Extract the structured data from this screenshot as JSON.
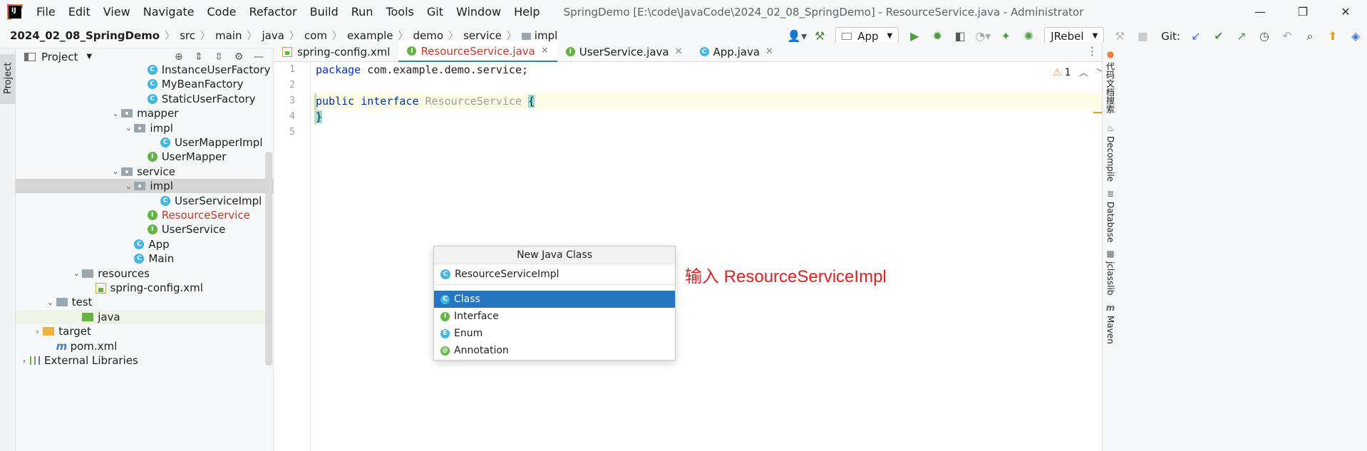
{
  "window": {
    "title": "SpringDemo [E:\\code\\JavaCode\\2024_02_08_SpringDemo] - ResourceService.java - Administrator"
  },
  "menu": [
    "File",
    "Edit",
    "View",
    "Navigate",
    "Code",
    "Refactor",
    "Build",
    "Run",
    "Tools",
    "Git",
    "Window",
    "Help"
  ],
  "window_controls": {
    "minimize": "—",
    "restore": "❐",
    "close": "✕"
  },
  "breadcrumb": [
    "2024_02_08_SpringDemo",
    "src",
    "main",
    "java",
    "com",
    "example",
    "demo",
    "service",
    "impl"
  ],
  "toolbar": {
    "run_config": "App",
    "jrebel": "JRebel",
    "git_label": "Git:",
    "icons": [
      "user-icon",
      "hammer-icon",
      "run-icon",
      "debug-icon",
      "coverage-icon",
      "profile-icon",
      "jrebel-run-icon",
      "jrebel-debug-icon",
      "stop-icon",
      "update-icon",
      "commit-icon",
      "push-icon",
      "history-icon",
      "rollback-icon",
      "search-icon",
      "updates-icon",
      "toolbox-icon"
    ]
  },
  "left_stripe": {
    "project_tab": "Project"
  },
  "project_panel": {
    "title": "Project",
    "tree": [
      {
        "label": "InstanceUserFactory",
        "icon": "class",
        "indent": 9
      },
      {
        "label": "MyBeanFactory",
        "icon": "class",
        "indent": 9
      },
      {
        "label": "StaticUserFactory",
        "icon": "class",
        "indent": 9
      },
      {
        "label": "mapper",
        "icon": "package",
        "indent": 7,
        "arrow": "⌄"
      },
      {
        "label": "impl",
        "icon": "package",
        "indent": 8,
        "arrow": "⌄"
      },
      {
        "label": "UserMapperImpl",
        "icon": "class",
        "indent": 10
      },
      {
        "label": "UserMapper",
        "icon": "interface",
        "indent": 9
      },
      {
        "label": "service",
        "icon": "package",
        "indent": 7,
        "arrow": "⌄"
      },
      {
        "label": "impl",
        "icon": "package",
        "indent": 8,
        "arrow": "⌄",
        "selected": true
      },
      {
        "label": "UserServiceImpl",
        "icon": "class",
        "indent": 10
      },
      {
        "label": "ResourceService",
        "icon": "interface",
        "indent": 9,
        "red": true
      },
      {
        "label": "UserService",
        "icon": "interface",
        "indent": 9
      },
      {
        "label": "App",
        "icon": "class-run",
        "indent": 8
      },
      {
        "label": "Main",
        "icon": "class-run",
        "indent": 8
      },
      {
        "label": "resources",
        "icon": "folder-res",
        "indent": 4,
        "arrow": "⌄"
      },
      {
        "label": "spring-config.xml",
        "icon": "xml",
        "indent": 5
      },
      {
        "label": "test",
        "icon": "folder",
        "indent": 2,
        "arrow": "⌄"
      },
      {
        "label": "java",
        "icon": "folder-green",
        "indent": 4,
        "highlight": true
      },
      {
        "label": "target",
        "icon": "folder-orange",
        "indent": 1,
        "arrow": "›"
      },
      {
        "label": "pom.xml",
        "icon": "maven",
        "indent": 2
      },
      {
        "label": "External Libraries",
        "icon": "library",
        "indent": 0,
        "arrow": "›"
      }
    ]
  },
  "tabs": [
    {
      "label": "spring-config.xml",
      "icon": "xml"
    },
    {
      "label": "ResourceService.java",
      "icon": "interface",
      "active": true
    },
    {
      "label": "UserService.java",
      "icon": "interface"
    },
    {
      "label": "App.java",
      "icon": "class-run"
    }
  ],
  "editor": {
    "line_numbers": [
      "1",
      "2",
      "3",
      "4",
      "5"
    ],
    "line1": {
      "kw": "package",
      "rest": " com.example.demo.service;"
    },
    "line3": {
      "kw1": "public",
      "kw2": "interface",
      "name": "ResourceService",
      "brace": "{"
    },
    "line4": {
      "brace": "}"
    },
    "warning_count": "1"
  },
  "right_tools": [
    "代码文档搜索",
    "Decompile",
    "Database",
    "jclasslib",
    "Maven"
  ],
  "popup": {
    "title": "New Java Class",
    "input_value": "ResourceServiceImpl",
    "options": [
      {
        "label": "Class",
        "icon": "C",
        "selected": true
      },
      {
        "label": "Interface",
        "icon": "I"
      },
      {
        "label": "Enum",
        "icon": "E"
      },
      {
        "label": "Annotation",
        "icon": "@"
      }
    ]
  },
  "annotation": "输入 ResourceServiceImpl",
  "colors": {
    "accent": "#3574f0",
    "selection": "#2675bf",
    "annotation": "#e02020",
    "keyword": "#0033b3"
  }
}
